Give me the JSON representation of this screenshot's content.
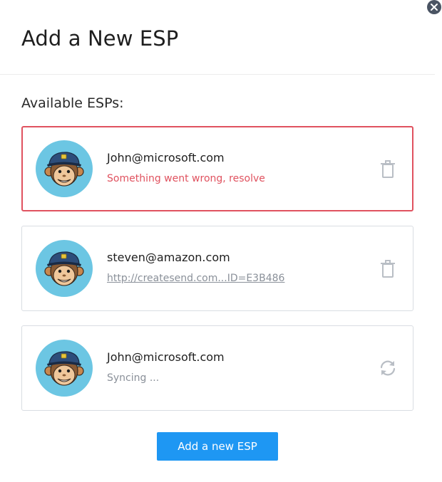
{
  "dialog": {
    "title": "Add a New ESP",
    "section_label": "Available ESPs:",
    "close_icon": "close-icon"
  },
  "esps": [
    {
      "email": "John@microsoft.com",
      "status": "Something went wrong, resolve",
      "status_type": "error",
      "action_icon": "trash-icon",
      "avatar_icon": "mailchimp-monkey-avatar"
    },
    {
      "email": "steven@amazon.com",
      "status": "http://createsend.com...ID=E3B486",
      "status_type": "link",
      "action_icon": "trash-icon",
      "avatar_icon": "mailchimp-monkey-avatar"
    },
    {
      "email": "John@microsoft.com",
      "status": "Syncing ...",
      "status_type": "syncing",
      "action_icon": "sync-icon",
      "avatar_icon": "mailchimp-monkey-avatar"
    }
  ],
  "footer": {
    "add_button_label": "Add a new ESP"
  },
  "colors": {
    "error": "#e0525f",
    "primary_button": "#1e97f3",
    "avatar_background": "#6cc6e3",
    "muted_text": "#8a9099"
  }
}
